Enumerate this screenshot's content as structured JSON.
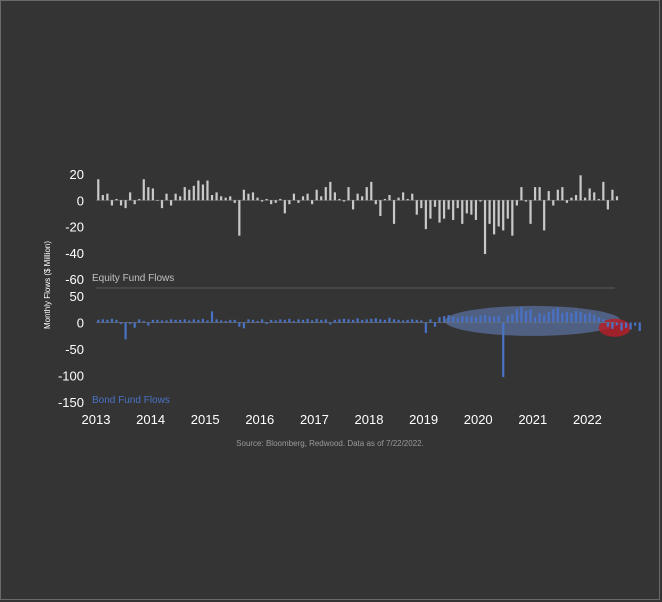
{
  "chart_data": {
    "type": "bar",
    "ylabel": "Monthly Flows ($ Million)",
    "source": "Source: Bloomberg, Redwood. Data as of 7/22/2022.",
    "x_ticks": [
      "2013",
      "2014",
      "2015",
      "2016",
      "2017",
      "2018",
      "2019",
      "2020",
      "2021",
      "2022"
    ],
    "x_start": "2013-01",
    "colors": {
      "equity": "#c9c9c9",
      "bond": "#4a72c4",
      "title_equity": "#c0c0c0",
      "title_bond": "#4a72c4",
      "highlight_positive": "#5a6f9e",
      "highlight_negative": "#b3202a"
    },
    "panels": [
      {
        "name": "Equity Fund Flows",
        "ylim": [
          -60,
          20
        ],
        "y_ticks": [
          "20",
          "0",
          "-20",
          "-40",
          "-60"
        ],
        "y_tick_values": [
          20,
          0,
          -20,
          -40,
          -60
        ],
        "values": [
          16,
          4,
          5,
          -4,
          1,
          -4,
          -6,
          6,
          -3,
          1,
          16,
          10,
          9,
          0,
          -6,
          5,
          -4,
          5,
          3,
          10,
          8,
          11,
          15,
          12,
          15,
          4,
          6,
          3,
          2,
          3,
          -2,
          -27,
          8,
          5,
          6,
          2,
          -1,
          1,
          -3,
          -2,
          1,
          -10,
          -3,
          5,
          -2,
          3,
          5,
          -3,
          8,
          3,
          10,
          14,
          6,
          1,
          -1,
          10,
          -7,
          5,
          3,
          10,
          14,
          -3,
          -12,
          1,
          4,
          -18,
          2,
          6,
          1,
          5,
          -11,
          -6,
          -22,
          -14,
          -5,
          -17,
          -14,
          -7,
          -15,
          -6,
          -18,
          -10,
          -11,
          -15,
          -1,
          -41,
          -18,
          -26,
          -20,
          -23,
          -14,
          -27,
          -4,
          10,
          -1,
          -18,
          10,
          10,
          -23,
          7,
          -4,
          8,
          10,
          -2,
          2,
          4,
          19,
          2,
          9,
          6,
          1,
          14,
          -7,
          8,
          3
        ]
      },
      {
        "name": "Bond Fund Flows",
        "ylim": [
          -150,
          50
        ],
        "y_ticks": [
          "50",
          "0",
          "-50",
          "-100",
          "-150"
        ],
        "y_tick_values": [
          50,
          0,
          -50,
          -100,
          -150
        ],
        "values": [
          5,
          6,
          5,
          7,
          5,
          -3,
          -32,
          -3,
          -10,
          6,
          3,
          -6,
          5,
          5,
          4,
          4,
          6,
          5,
          5,
          6,
          4,
          6,
          5,
          7,
          4,
          21,
          6,
          4,
          3,
          5,
          5,
          -8,
          -11,
          6,
          5,
          3,
          6,
          -3,
          5,
          4,
          6,
          5,
          7,
          3,
          6,
          5,
          7,
          4,
          7,
          5,
          6,
          -4,
          5,
          6,
          7,
          6,
          5,
          8,
          5,
          6,
          7,
          8,
          6,
          5,
          9,
          6,
          5,
          4,
          5,
          6,
          5,
          4,
          -20,
          6,
          -8,
          10,
          12,
          14,
          11,
          8,
          12,
          11,
          12,
          10,
          13,
          14,
          12,
          11,
          13,
          -103,
          13,
          16,
          25,
          29,
          22,
          25,
          10,
          18,
          14,
          20,
          25,
          28,
          18,
          20,
          18,
          22,
          20,
          16,
          18,
          14,
          10,
          6,
          -8,
          -12,
          -5,
          -15,
          -10,
          -13,
          -6,
          -16
        ]
      }
    ]
  }
}
